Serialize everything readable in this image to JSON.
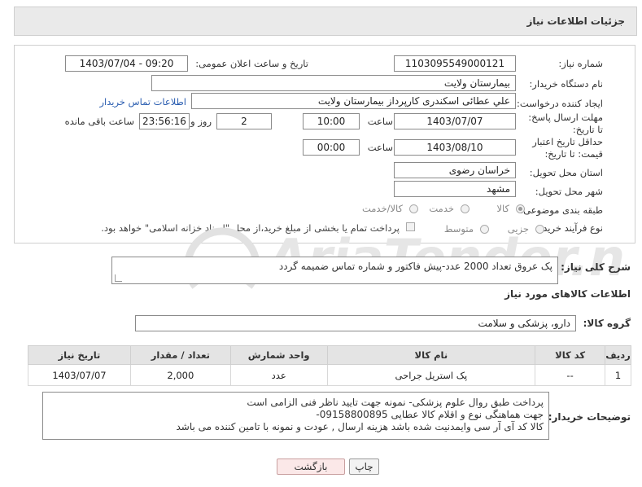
{
  "header": {
    "title": "جزئیات اطلاعات نیاز"
  },
  "fields": {
    "need_number_label": "شماره نیاز:",
    "need_number": "1103095549000121",
    "announce_label": "تاریخ و ساعت اعلان عمومی:",
    "announce_value": "1403/07/04 - 09:20",
    "buyer_org_label": "نام دستگاه خریدار:",
    "buyer_org": "بیمارستان ولایت",
    "creator_label": "ایجاد کننده درخواست:",
    "creator": "علي عطائی اسکندری کارپرداز بیمارستان ولایت",
    "contact_link": "اطلاعات تماس خریدار",
    "deadline_label": "مهلت ارسال پاسخ: تا تاریخ:",
    "deadline_date": "1403/07/07",
    "time_label": "ساعت",
    "deadline_time": "10:00",
    "days_value": "2",
    "days_label": "روز و",
    "remaining_time": "23:56:16",
    "remaining_label": "ساعت باقی مانده",
    "validity_label": "حداقل تاریخ اعتبار قیمت: تا تاریخ:",
    "validity_date": "1403/08/10",
    "validity_time_label": "ساعت",
    "validity_time": "00:00",
    "province_label": "استان محل تحویل:",
    "province": "خراسان رضوی",
    "city_label": "شهر محل تحویل:",
    "city": "مشهد",
    "category_label": "طبقه بندی موضوعی:",
    "category_options": [
      "کالا",
      "خدمت",
      "کالا/خدمت"
    ],
    "process_label": "نوع فرآیند خرید :",
    "process_options": [
      "جزیی",
      "متوسط"
    ],
    "payment_note": "پرداخت تمام یا بخشی از مبلغ خرید،از محل \"اسناد خزانه اسلامی\" خواهد بود."
  },
  "description": {
    "label": "شرح کلی نیاز:",
    "text": "پک عروق تعداد 2000 عدد-پیش فاکتور و شماره تماس ضمیمه گردد"
  },
  "goods_section": {
    "title": "اطلاعات کالاهای مورد نیاز",
    "group_label": "گروه کالا:",
    "group_value": "دارو، پزشکی و سلامت",
    "columns": [
      "ردیف",
      "کد کالا",
      "نام کالا",
      "واحد شمارش",
      "تعداد / مقدار",
      "تاریخ نیاز"
    ],
    "rows": [
      {
        "row": "1",
        "code": "--",
        "name": "پک استریل جراحی",
        "unit": "عدد",
        "qty": "2,000",
        "date": "1403/07/07"
      }
    ]
  },
  "buyer_notes": {
    "label": "توضیحات خریدار:",
    "lines": [
      "پرداخت طبق روال علوم پزشکی-  نمونه جهت تایید ناظر فنی الزامی است",
      "جهت هماهنگی نوع و اقلام کالا  عطایی 09158800895-",
      "کالا کد آی آر سی وایمدنیت شده باشد هزینه ارسال , عودت و نمونه با تامین کننده می باشد"
    ]
  },
  "buttons": {
    "print": "چاپ",
    "back": "بازگشت"
  },
  "watermark": {
    "text": "AriaTender.neT"
  },
  "colors": {
    "link": "#2a5db0",
    "back_button": "#fbe8e8",
    "header_bg": "#eaeaea"
  }
}
